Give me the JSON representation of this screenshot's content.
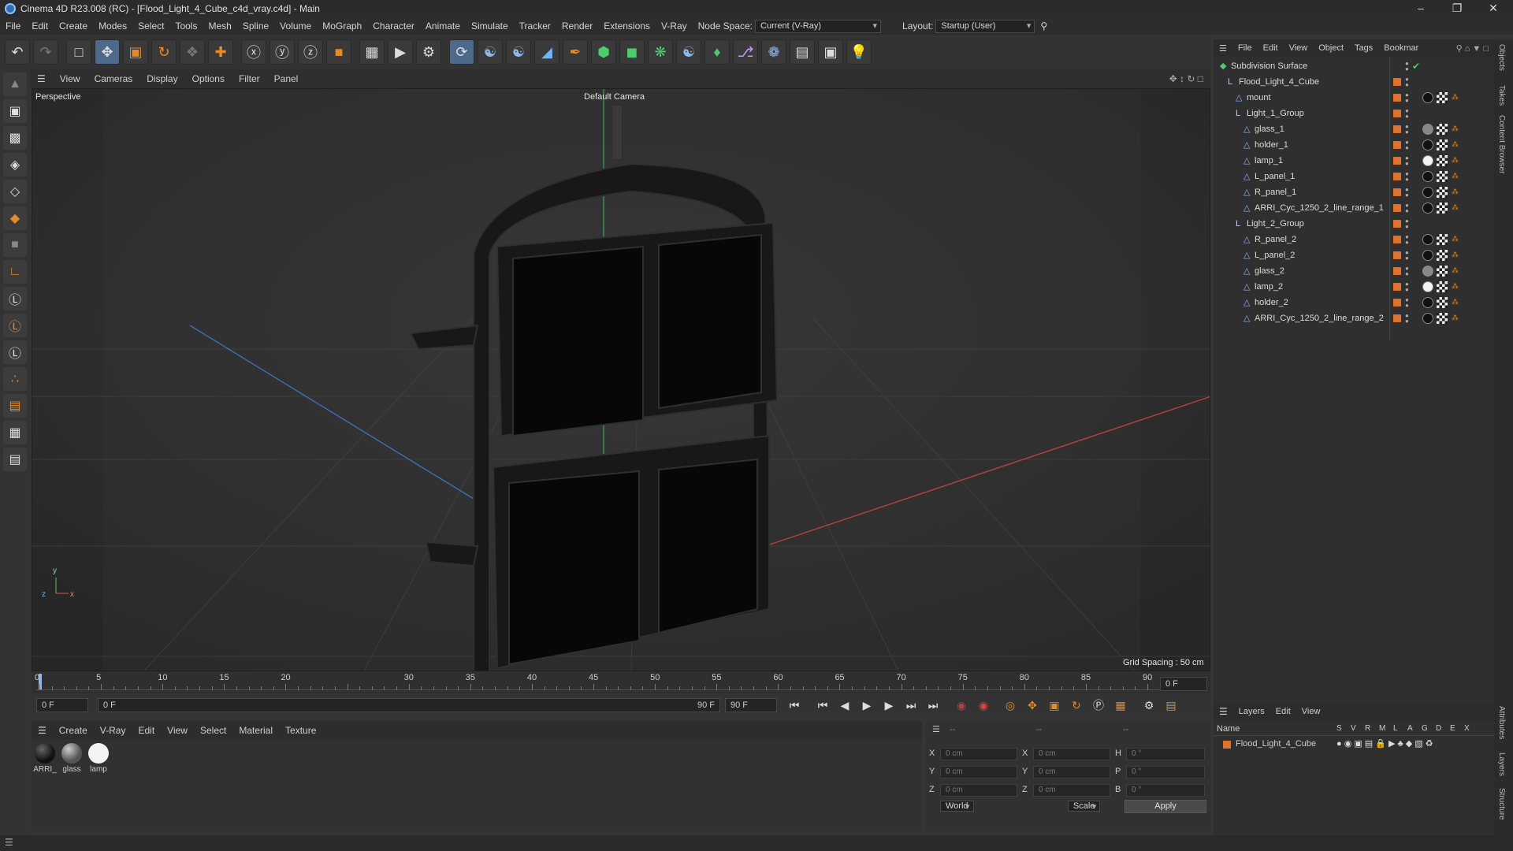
{
  "window": {
    "title": "Cinema 4D R23.008 (RC) - [Flood_Light_4_Cube_c4d_vray.c4d] - Main"
  },
  "menubar": {
    "items": [
      "File",
      "Edit",
      "Create",
      "Modes",
      "Select",
      "Tools",
      "Mesh",
      "Spline",
      "Volume",
      "MoGraph",
      "Character",
      "Animate",
      "Simulate",
      "Tracker",
      "Render",
      "Extensions",
      "V-Ray"
    ],
    "node_space_label": "Node Space:",
    "node_space_value": "Current (V-Ray)",
    "layout_label": "Layout:",
    "layout_value": "Startup (User)"
  },
  "viewport": {
    "menu": [
      "View",
      "Cameras",
      "Display",
      "Options",
      "Filter",
      "Panel"
    ],
    "label": "Perspective",
    "camera": "Default Camera",
    "grid_spacing": "Grid Spacing : 50 cm"
  },
  "timeline": {
    "ticks": [
      "0",
      "5",
      "10",
      "15",
      "20",
      "30",
      "35",
      "40",
      "45",
      "50",
      "55",
      "60",
      "65",
      "70",
      "75",
      "80",
      "85",
      "90"
    ],
    "current_frame_field": "0 F",
    "start_field": "0 F",
    "range_start": "0 F",
    "range_end": "90 F",
    "end_field": "90 F"
  },
  "materials": {
    "menu": [
      "Create",
      "V-Ray",
      "Edit",
      "View",
      "Select",
      "Material",
      "Texture"
    ],
    "items": [
      "ARRI_",
      "glass",
      "lamp"
    ]
  },
  "coords": {
    "header_left": "--",
    "header_mid": "--",
    "header_right": "--",
    "x_pos": "0 cm",
    "y_pos": "0 cm",
    "z_pos": "0 cm",
    "x_size": "0 cm",
    "y_size": "0 cm",
    "z_size": "0 cm",
    "h_rot": "0 °",
    "p_rot": "0 °",
    "b_rot": "0 °",
    "space": "World",
    "mode": "Scale",
    "apply": "Apply"
  },
  "object_manager": {
    "menu": [
      "File",
      "Edit",
      "View",
      "Object",
      "Tags",
      "Bookmar"
    ],
    "objects": [
      {
        "name": "Subdivision Surface",
        "depth": 0
      },
      {
        "name": "Flood_Light_4_Cube",
        "depth": 1
      },
      {
        "name": "mount",
        "depth": 2
      },
      {
        "name": "Light_1_Group",
        "depth": 2
      },
      {
        "name": "glass_1",
        "depth": 3
      },
      {
        "name": "holder_1",
        "depth": 3
      },
      {
        "name": "lamp_1",
        "depth": 3
      },
      {
        "name": "L_panel_1",
        "depth": 3
      },
      {
        "name": "R_panel_1",
        "depth": 3
      },
      {
        "name": "ARRI_Cyc_1250_2_line_range_1",
        "depth": 3
      },
      {
        "name": "Light_2_Group",
        "depth": 2
      },
      {
        "name": "R_panel_2",
        "depth": 3
      },
      {
        "name": "L_panel_2",
        "depth": 3
      },
      {
        "name": "glass_2",
        "depth": 3
      },
      {
        "name": "lamp_2",
        "depth": 3
      },
      {
        "name": "holder_2",
        "depth": 3
      },
      {
        "name": "ARRI_Cyc_1250_2_line_range_2",
        "depth": 3
      }
    ]
  },
  "layers": {
    "menu": [
      "Layers",
      "Edit",
      "View"
    ],
    "name_header": "Name",
    "col_headers": [
      "S",
      "V",
      "R",
      "M",
      "L",
      "A",
      "G",
      "D",
      "E",
      "X"
    ],
    "layer_name": "Flood_Light_4_Cube"
  },
  "right_tabs": [
    "Objects",
    "Takes",
    "Content Browser",
    "Attributes",
    "Layers",
    "Structure"
  ],
  "colors": {
    "accent": "#e0732b",
    "selection": "#4d6a8a"
  }
}
